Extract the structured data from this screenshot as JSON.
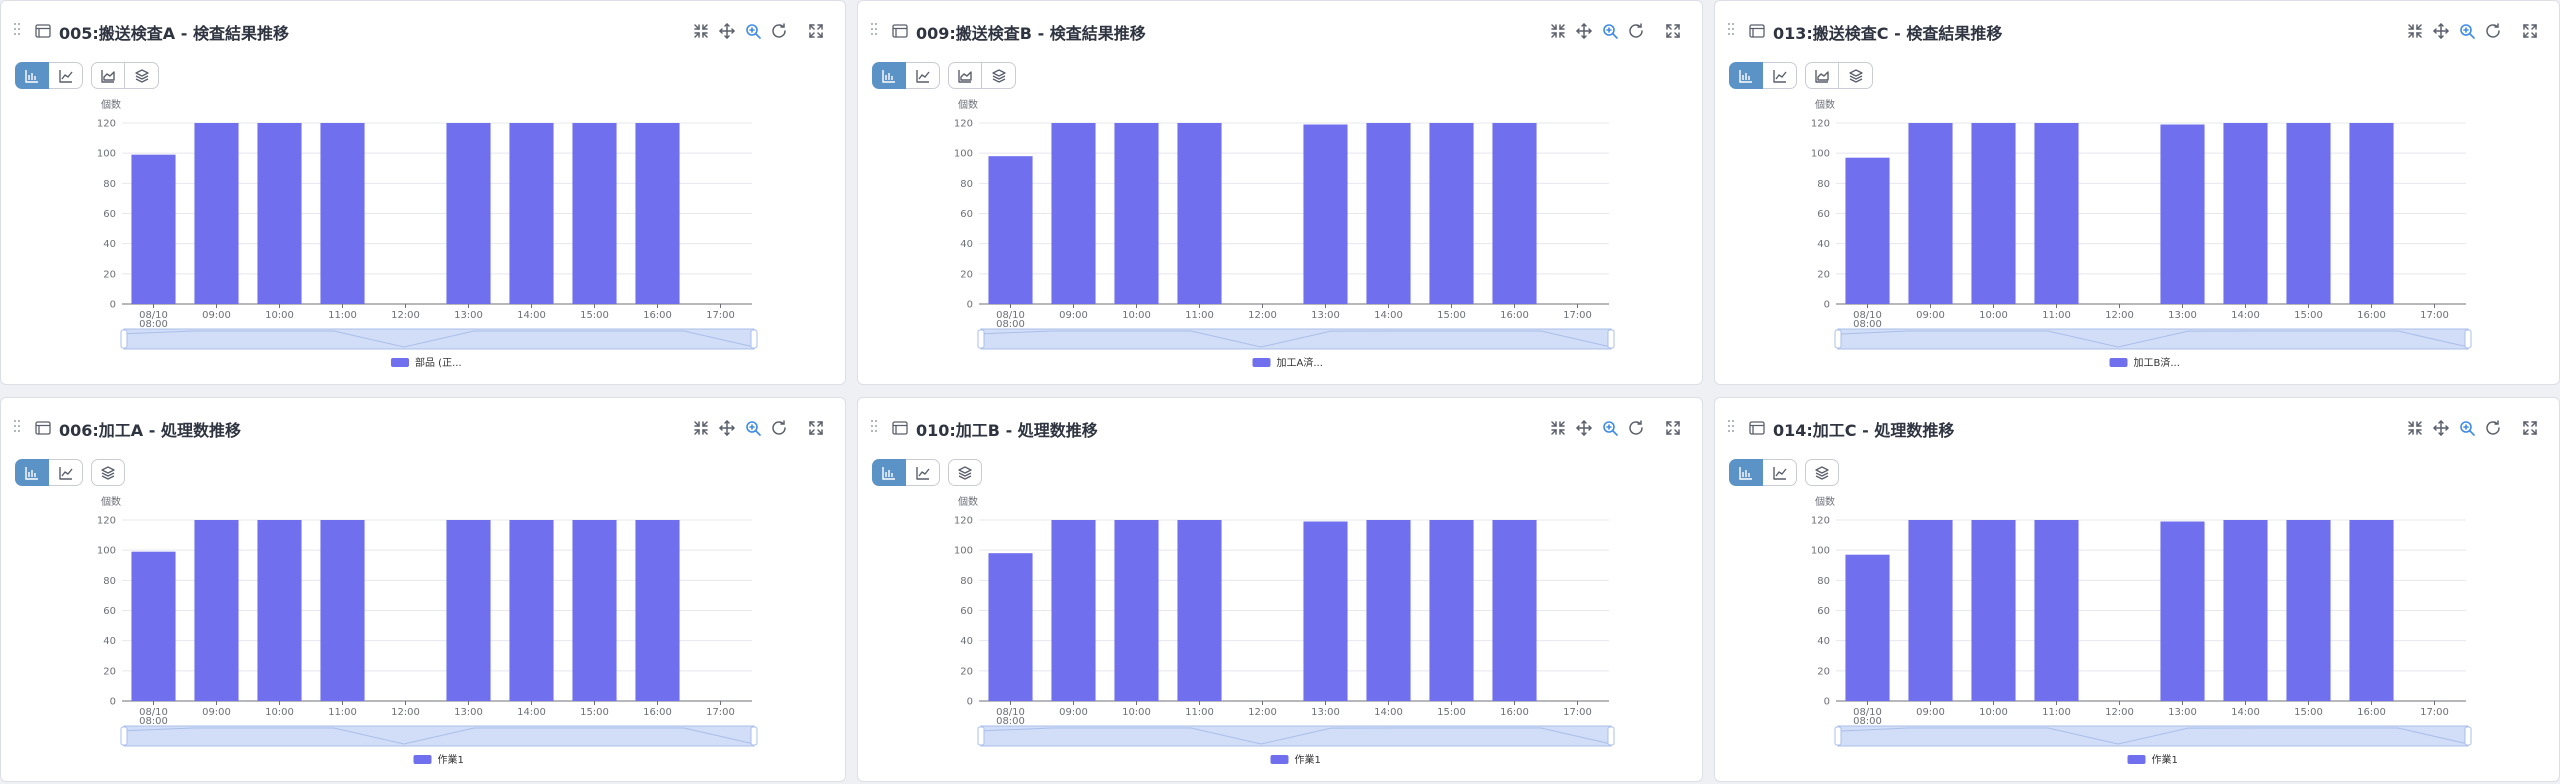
{
  "colors": {
    "bar": "#7070ee",
    "active_button": "#5b93c6",
    "zoom_icon": "#3f8be6",
    "slider_fill": "#d2ddf8",
    "slider_border": "#a9bfe9"
  },
  "panels": [
    {
      "title": "005:搬送検査A - 検査結果推移",
      "toolbar": [
        "restore-icon",
        "pan-icon",
        "zoom-icon",
        "refresh-icon",
        "fullscreen-icon"
      ],
      "buttons": [
        "bar-chart-icon",
        "line-chart-icon",
        "area-chart-icon",
        "stack-icon"
      ],
      "chart_data": {
        "type": "bar",
        "ylabel": "個数",
        "ylim": [
          0,
          120
        ],
        "yticks": [
          0,
          20,
          40,
          60,
          80,
          100,
          120
        ],
        "categories": [
          "08/10\n08:00",
          "09:00",
          "10:00",
          "11:00",
          "12:00",
          "13:00",
          "14:00",
          "15:00",
          "16:00",
          "17:00"
        ],
        "series": [
          {
            "name": "部品 (正...",
            "values": [
              99,
              120,
              120,
              120,
              0,
              120,
              120,
              120,
              120,
              0
            ]
          }
        ],
        "legend": "bottom"
      }
    },
    {
      "title": "009:搬送検査B - 検査結果推移",
      "toolbar": [
        "restore-icon",
        "pan-icon",
        "zoom-icon",
        "refresh-icon",
        "fullscreen-icon"
      ],
      "buttons": [
        "bar-chart-icon",
        "line-chart-icon",
        "area-chart-icon",
        "stack-icon"
      ],
      "chart_data": {
        "type": "bar",
        "ylabel": "個数",
        "ylim": [
          0,
          120
        ],
        "yticks": [
          0,
          20,
          40,
          60,
          80,
          100,
          120
        ],
        "categories": [
          "08/10\n08:00",
          "09:00",
          "10:00",
          "11:00",
          "12:00",
          "13:00",
          "14:00",
          "15:00",
          "16:00",
          "17:00"
        ],
        "series": [
          {
            "name": "加工A済...",
            "values": [
              98,
              120,
              120,
              120,
              0,
              119,
              120,
              120,
              120,
              0
            ]
          }
        ],
        "legend": "bottom"
      }
    },
    {
      "title": "013:搬送検査C - 検査結果推移",
      "toolbar": [
        "restore-icon",
        "pan-icon",
        "zoom-icon",
        "refresh-icon",
        "fullscreen-icon"
      ],
      "buttons": [
        "bar-chart-icon",
        "line-chart-icon",
        "area-chart-icon",
        "stack-icon"
      ],
      "chart_data": {
        "type": "bar",
        "ylabel": "個数",
        "ylim": [
          0,
          120
        ],
        "yticks": [
          0,
          20,
          40,
          60,
          80,
          100,
          120
        ],
        "categories": [
          "08/10\n08:00",
          "09:00",
          "10:00",
          "11:00",
          "12:00",
          "13:00",
          "14:00",
          "15:00",
          "16:00",
          "17:00"
        ],
        "series": [
          {
            "name": "加工B済...",
            "values": [
              97,
              120,
              120,
              120,
              0,
              119,
              120,
              120,
              120,
              0
            ]
          }
        ],
        "legend": "bottom"
      }
    },
    {
      "title": "006:加工A - 処理数推移",
      "toolbar": [
        "restore-icon",
        "pan-icon",
        "zoom-icon",
        "refresh-icon",
        "fullscreen-icon"
      ],
      "buttons": [
        "bar-chart-icon",
        "line-chart-icon",
        "stack-icon"
      ],
      "chart_data": {
        "type": "bar",
        "ylabel": "個数",
        "ylim": [
          0,
          120
        ],
        "yticks": [
          0,
          20,
          40,
          60,
          80,
          100,
          120
        ],
        "categories": [
          "08/10\n08:00",
          "09:00",
          "10:00",
          "11:00",
          "12:00",
          "13:00",
          "14:00",
          "15:00",
          "16:00",
          "17:00"
        ],
        "series": [
          {
            "name": "作業1",
            "values": [
              99,
              120,
              120,
              120,
              0,
              120,
              120,
              120,
              120,
              0
            ]
          }
        ],
        "legend": "bottom"
      }
    },
    {
      "title": "010:加工B - 処理数推移",
      "toolbar": [
        "restore-icon",
        "pan-icon",
        "zoom-icon",
        "refresh-icon",
        "fullscreen-icon"
      ],
      "buttons": [
        "bar-chart-icon",
        "line-chart-icon",
        "stack-icon"
      ],
      "chart_data": {
        "type": "bar",
        "ylabel": "個数",
        "ylim": [
          0,
          120
        ],
        "yticks": [
          0,
          20,
          40,
          60,
          80,
          100,
          120
        ],
        "categories": [
          "08/10\n08:00",
          "09:00",
          "10:00",
          "11:00",
          "12:00",
          "13:00",
          "14:00",
          "15:00",
          "16:00",
          "17:00"
        ],
        "series": [
          {
            "name": "作業1",
            "values": [
              98,
              120,
              120,
              120,
              0,
              119,
              120,
              120,
              120,
              0
            ]
          }
        ],
        "legend": "bottom"
      }
    },
    {
      "title": "014:加工C - 処理数推移",
      "toolbar": [
        "restore-icon",
        "pan-icon",
        "zoom-icon",
        "refresh-icon",
        "fullscreen-icon"
      ],
      "buttons": [
        "bar-chart-icon",
        "line-chart-icon",
        "stack-icon"
      ],
      "chart_data": {
        "type": "bar",
        "ylabel": "個数",
        "ylim": [
          0,
          120
        ],
        "yticks": [
          0,
          20,
          40,
          60,
          80,
          100,
          120
        ],
        "categories": [
          "08/10\n08:00",
          "09:00",
          "10:00",
          "11:00",
          "12:00",
          "13:00",
          "14:00",
          "15:00",
          "16:00",
          "17:00"
        ],
        "series": [
          {
            "name": "作業1",
            "values": [
              97,
              120,
              120,
              120,
              0,
              119,
              120,
              120,
              120,
              0
            ]
          }
        ],
        "legend": "bottom"
      }
    }
  ]
}
